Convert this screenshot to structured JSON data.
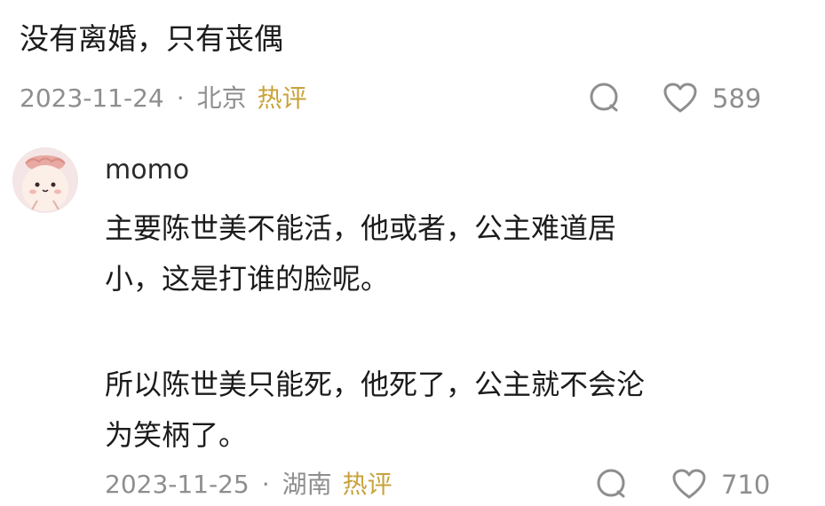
{
  "top_comment": {
    "text": "没有离婚，只有丧偶",
    "date": "2023-11-24",
    "separator": "·",
    "location": "北京",
    "hot_label": "热评",
    "likes": "589"
  },
  "reply": {
    "username": "momo",
    "paragraph1": "主要陈世美不能活，他或者，公主难道居\n小，这是打谁的脸呢。",
    "paragraph2": "所以陈世美只能死，他死了，公主就不会沦\n为笑柄了。",
    "date": "2023-11-25",
    "separator": "·",
    "location": "湖南",
    "hot_label": "热评",
    "likes": "710"
  },
  "icons": {
    "reply": "comment-bubble-icon",
    "like": "heart-outline-icon"
  },
  "colors": {
    "text": "#1b1b1b",
    "meta": "#8e8e8e",
    "hot": "#c9a23a"
  }
}
